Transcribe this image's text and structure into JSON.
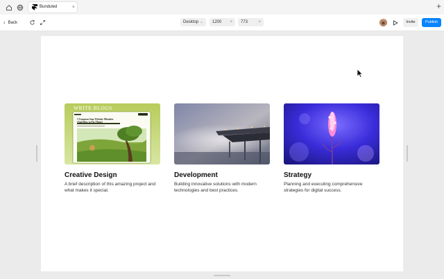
{
  "browser": {
    "tab_title": "Bunduled",
    "tab_close": "×",
    "new_tab": "+"
  },
  "toolbar": {
    "back_label": "Back",
    "back_chevron": "‹",
    "device": "Desktop",
    "device_chevron": "⌄",
    "width": "1200",
    "height": "773",
    "clear": "×",
    "invite_label": "Invite",
    "publish_label": "Publish"
  },
  "thumb": {
    "blog_title": "WRITE BLOGS",
    "blog_heading": "5 Common Saas Website Mistakes (And How to Fix Them)"
  },
  "cards": [
    {
      "title": "Creative Design",
      "description": "A brief description of this amazing project and what makes it special."
    },
    {
      "title": "Development",
      "description": "Building innovative solutions with modern technologies and best practices."
    },
    {
      "title": "Strategy",
      "description": "Planning and executing comprehensive strategies for digital success."
    }
  ],
  "colors": {
    "accent": "#0a84ff",
    "canvas_bg": "#ffffff",
    "workspace_bg": "#ebebeb"
  },
  "icons": [
    "home-icon",
    "globe-icon",
    "refresh-icon",
    "expand-icon",
    "play-icon",
    "cursor-icon"
  ]
}
